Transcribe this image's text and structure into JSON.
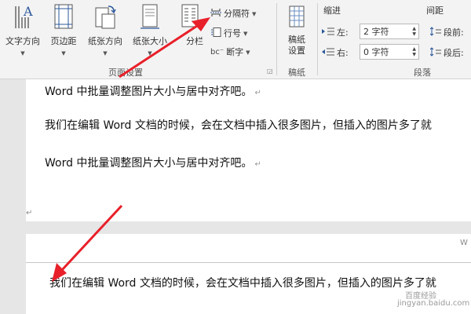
{
  "ribbon": {
    "text_direction": "文字方向",
    "margins": "页边距",
    "orientation": "纸张方向",
    "size": "纸张大小",
    "columns": "分栏",
    "breaks": "分隔符",
    "line_numbers": "行号",
    "hyphenation": "断字",
    "page_setup_group": "页面设置",
    "manuscript_settings": "稿纸设置",
    "manuscript_group": "稿纸",
    "indent_title": "缩进",
    "spacing_title": "间距",
    "indent_left_label": "左:",
    "indent_left_value": "2 字符",
    "indent_right_label": "右:",
    "indent_right_value": "0 字符",
    "spacing_before_label": "段前:",
    "spacing_after_label": "段后:",
    "paragraph_group": "段落"
  },
  "document": {
    "page1_lines": [
      "Word 中批量调整图片大小与居中对齐吧。",
      "我们在编辑 Word 文档的时候，会在文档中插入很多图片，但插入的图片多了就",
      "Word 中批量调整图片大小与居中对齐吧。"
    ],
    "page2_line": "我们在编辑 Word 文档的时候，会在文档中插入很多图片，但插入的图片多了就",
    "paragraph_mark": "↵",
    "header_corner": "W",
    "watermark_cn": "百度经验",
    "watermark_url": "jingyan.baidu.com"
  },
  "colors": {
    "arrow": "#e8202a",
    "ribbon_bg": "#f3f3f3",
    "page_gap": "#e6e6e6"
  }
}
